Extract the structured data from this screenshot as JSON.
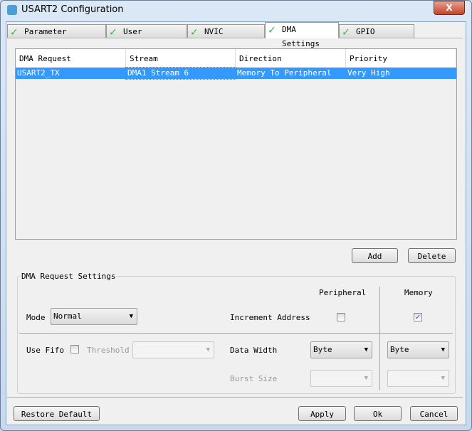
{
  "window": {
    "title": "USART2 Configuration",
    "close_label": "X"
  },
  "tabs": [
    {
      "label": "Parameter Settings"
    },
    {
      "label": "User Constants"
    },
    {
      "label": "NVIC Settings"
    },
    {
      "label": "DMA Settings",
      "selected": true
    },
    {
      "label": "GPIO Settings"
    }
  ],
  "table": {
    "headers": [
      "DMA Request",
      "Stream",
      "Direction",
      "Priority"
    ],
    "rows": [
      [
        "USART2_TX",
        "DMA1 Stream 6",
        "Memory To Peripheral",
        "Very High"
      ]
    ]
  },
  "buttons": {
    "add": "Add",
    "delete": "Delete",
    "restore": "Restore Default",
    "apply": "Apply",
    "ok": "Ok",
    "cancel": "Cancel"
  },
  "settings": {
    "legend": "DMA Request Settings",
    "peripheral": "Peripheral",
    "memory": "Memory",
    "mode_label": "Mode",
    "mode_value": "Normal",
    "increment_label": "Increment Address",
    "peripheral_increment": false,
    "memory_increment": true,
    "use_fifo_label": "Use Fifo",
    "threshold_label": "Threshold",
    "data_width_label": "Data Width",
    "peripheral_width": "Byte",
    "memory_width": "Byte",
    "burst_size_label": "Burst Size",
    "check_mark": "✓"
  },
  "colors": {
    "selection": "#3399ff",
    "check": "#3bb53b"
  }
}
